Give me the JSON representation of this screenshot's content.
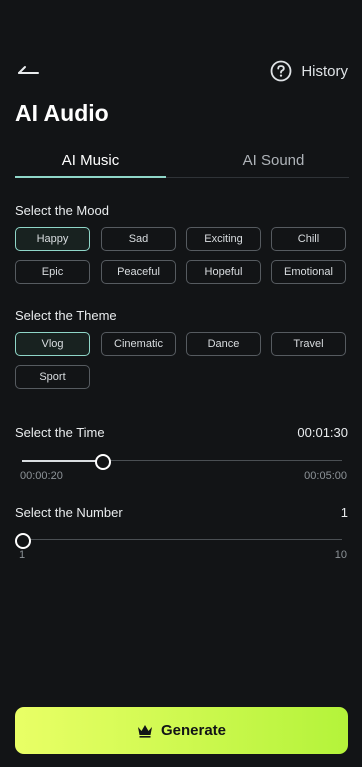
{
  "header": {
    "back_icon": "arrow-left-icon",
    "help_icon": "question-circle-icon",
    "history_label": "History"
  },
  "page_title": "AI Audio",
  "tabs": [
    {
      "label": "AI Music",
      "active": true
    },
    {
      "label": "AI Sound",
      "active": false
    }
  ],
  "mood": {
    "title": "Select the Mood",
    "options": [
      "Happy",
      "Sad",
      "Exciting",
      "Chill",
      "Epic",
      "Peaceful",
      "Hopeful",
      "Emotional"
    ],
    "selected": "Happy"
  },
  "theme": {
    "title": "Select the Theme",
    "options": [
      "Vlog",
      "Cinematic",
      "Dance",
      "Travel",
      "Sport"
    ],
    "selected": "Vlog"
  },
  "time": {
    "title": "Select the Time",
    "value": "00:01:30",
    "min": "00:00:20",
    "max": "00:05:00",
    "fraction": 0.25
  },
  "number": {
    "title": "Select the Number",
    "value": "1",
    "min": "1",
    "max": "10",
    "fraction": 0
  },
  "generate": {
    "label": "Generate",
    "icon": "crown-icon"
  },
  "colors": {
    "accent": "#8fd6c8",
    "button_start": "#e9ff66",
    "button_end": "#b4f33a",
    "background": "#121416"
  }
}
